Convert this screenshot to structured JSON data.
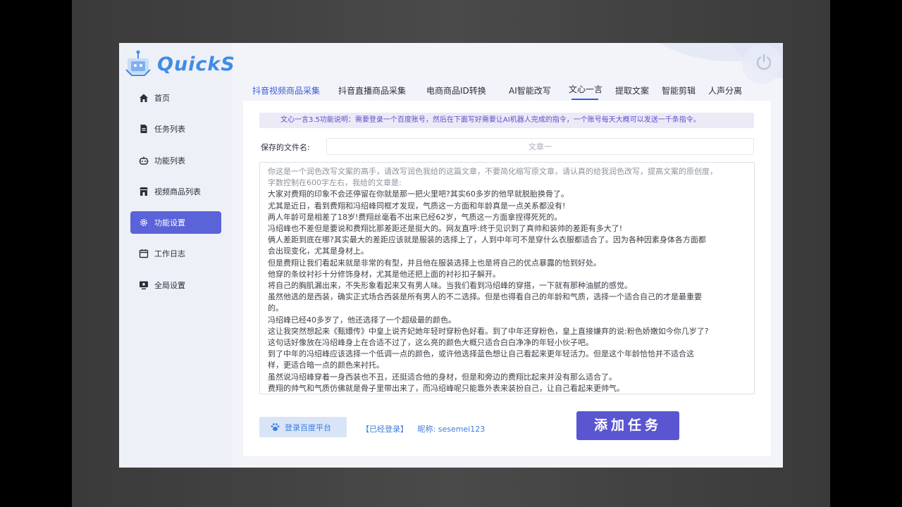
{
  "app": {
    "logo_text": "QuickS"
  },
  "sidebar": {
    "items": [
      {
        "label": "首页",
        "icon": "home-icon"
      },
      {
        "label": "任务列表",
        "icon": "document-icon"
      },
      {
        "label": "功能列表",
        "icon": "robot-icon"
      },
      {
        "label": "视频商品列表",
        "icon": "store-icon"
      },
      {
        "label": "功能设置",
        "icon": "gear-icon",
        "active": true
      },
      {
        "label": "工作日志",
        "icon": "calendar-icon"
      },
      {
        "label": "全局设置",
        "icon": "monitor-icon"
      }
    ]
  },
  "tabs": [
    {
      "label": "抖音视频商品采集"
    },
    {
      "label": "抖音直播商品采集"
    },
    {
      "label": "电商商品ID转换"
    },
    {
      "label": "AI智能改写"
    },
    {
      "label": "文心一言",
      "active": true
    },
    {
      "label": "提取文案"
    },
    {
      "label": "智能剪辑"
    },
    {
      "label": "人声分离"
    }
  ],
  "main": {
    "notice": "文心一言3.5功能说明：需要登录一个百度账号，然后在下面写好需要让AI机器人完成的指令，一个账号每天大概可以发送一千条指令。",
    "filename_label": "保存的文件名:",
    "filename_placeholder": "文章一",
    "prompt_lines": [
      "你这是一个润色改写文案的高手，请改写润色我给的这篇文章，不要简化缩写原文章，请认真的给我润色改写，提高文案的原创度，",
      "字数控制在600字左右，我给的文章是:",
      "大家对费翔的印象不会还停留在你就是那一把火里吧?其实60多岁的他早就脱胎换骨了。",
      "尤其是近日，看到费翔和冯绍峰同框才发现，气质这一方面和年龄真是一点关系都没有!",
      "两人年龄可是相差了18岁!费翔丝毫看不出来已经62岁，气质这一方面拿捏得死死的。",
      "冯绍峰也不差但是要说和费翔比那差距还是挺大的。网友直呼:终于见识到了真帅和装帅的差距有多大了!",
      "俩人差距到底在哪?其实最大的差距应该就是服装的选择上了，人到中年可不是穿什么衣服都适合了。因为各种因素身体各方面都",
      "会出现变化，尤其是身材上。",
      "但是费翔让我们看起来就是非常的有型，并且他在服装选择上也是将自己的优点暴露的恰到好处。",
      "他穿的条纹衬衫十分修饰身材，尤其是他还把上面的衬衫扣子解开。",
      "将自己的胸肌漏出来，不失形象看起来又有男人味。当我们看到冯绍峰的穿搭，一下就有那种油腻的感觉。",
      "虽然他选的是西装，确实正式场合西装是所有男人的不二选择。但是也得看自己的年龄和气质，选择一个适合自己的才是最重要",
      "的。",
      "冯绍峰已经40多岁了，他还选择了一个超级最的颜色。",
      "这让我突然想起来《甄嬛传》中皇上说齐妃她年轻时穿粉色好看。到了中年还穿粉色，皇上直接嫌弃的说:粉色娇嫩如今你几岁了?",
      "这句话好像放在冯绍峰身上在合适不过了，这么亮的颜色大概只适合白白净净的年轻小伙子吧。",
      "到了中年的冯绍峰应该选择一个低调一点的颜色，或许他选择蓝色想让自己看起来更年轻活力。但是这个年龄恰恰并不适合这",
      "样，更适合暗一点的颜色来衬托。",
      "虽然说冯绍峰穿着一身西装也不丑，还挺适合他的身材，但是和旁边的费翔比起来并没有那么适合了。",
      "费翔的帅气和气质仿佛就是骨子里带出来了，而冯绍峰呢只能靠外表来装扮自己，让自己看起来更帅气。"
    ],
    "baidu_login_button": "登录百度平台",
    "login_status": "【已经登录】",
    "nickname_label": "昵称:",
    "nickname_value": "sesemei123",
    "add_task_button": "添加任务"
  },
  "colors": {
    "accent": "#5a63d8",
    "tab_active": "#3a5bd8",
    "link_blue": "#3a7ce0",
    "notice_text": "#5b50c8"
  }
}
